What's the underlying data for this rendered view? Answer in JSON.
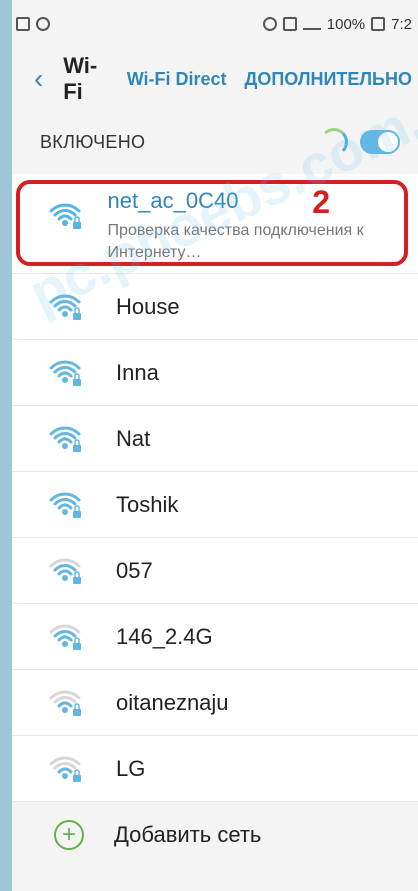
{
  "status_bar": {
    "battery_percent": "100%",
    "time": "7:2"
  },
  "top_bar": {
    "title": "Wi-Fi",
    "tabs": [
      "Wi-Fi Direct",
      "ДОПОЛНИТЕЛЬНО"
    ]
  },
  "wifi_switch": {
    "label": "ВКЛЮЧЕНО",
    "enabled": true
  },
  "networks": [
    {
      "name": "net_ac_0C40",
      "status": "Проверка качества подключения к Интернету…",
      "active": true,
      "strength": 4
    },
    {
      "name": "House",
      "active": false,
      "strength": 4
    },
    {
      "name": "Inna",
      "active": false,
      "strength": 4
    },
    {
      "name": "Nat",
      "active": false,
      "strength": 4
    },
    {
      "name": "Toshik",
      "active": false,
      "strength": 3
    },
    {
      "name": "057",
      "active": false,
      "strength": 2
    },
    {
      "name": "146_2.4G",
      "active": false,
      "strength": 2
    },
    {
      "name": "oitaneznaju",
      "active": false,
      "strength": 1
    },
    {
      "name": "LG",
      "active": false,
      "strength": 1
    }
  ],
  "add_network": {
    "label": "Добавить сеть"
  },
  "annotation": {
    "marker": "2",
    "highlight_color": "#d51f21"
  },
  "watermark": {
    "text": "pc.phoebs.com.ua"
  },
  "colors": {
    "accent": "#2f86b8",
    "toggle": "#62b6e6",
    "add_icon": "#63b24a"
  }
}
